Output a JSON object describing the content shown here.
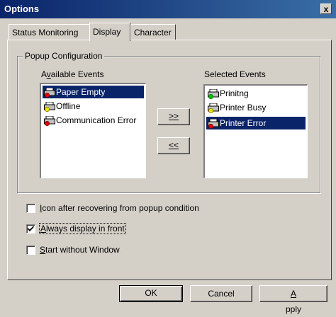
{
  "window": {
    "title": "Options",
    "close_label": "x"
  },
  "tabs": [
    {
      "label": "Status Monitoring",
      "active": false
    },
    {
      "label": "Display",
      "active": true
    },
    {
      "label": "Character",
      "active": false
    }
  ],
  "popup_config": {
    "group_label": "Popup Configuration",
    "available_label_pre": "A",
    "available_label_u": "v",
    "available_label_post": "ailable Events",
    "selected_label": "Selected Events",
    "available_events": [
      {
        "label": "Paper Empty",
        "selected": true,
        "icon": "printer-red-icon"
      },
      {
        "label": "Offline",
        "selected": false,
        "icon": "printer-yellow-icon"
      },
      {
        "label": "Communication Error",
        "selected": false,
        "icon": "printer-red-icon"
      }
    ],
    "selected_events": [
      {
        "label": "Prinitng",
        "selected": false,
        "icon": "printer-green-icon"
      },
      {
        "label": "Printer Busy",
        "selected": false,
        "icon": "printer-yellow-icon"
      },
      {
        "label": "Printer Error",
        "selected": true,
        "icon": "printer-red-icon"
      }
    ],
    "add_button": ">>",
    "remove_button": "<<"
  },
  "options": [
    {
      "u": "I",
      "rest": "con after recovering from popup condition",
      "checked": false
    },
    {
      "u": "A",
      "rest": "lways display in front",
      "checked": true
    },
    {
      "u": "S",
      "rest": "tart without Window",
      "checked": false
    }
  ],
  "buttons": {
    "ok": "OK",
    "cancel": "Cancel",
    "apply_u": "A",
    "apply_rest": "pply"
  },
  "colors": {
    "selection": "#0a246a",
    "face": "#d4d0c8",
    "title_start": "#0a246a",
    "title_end": "#3a6ea5"
  }
}
